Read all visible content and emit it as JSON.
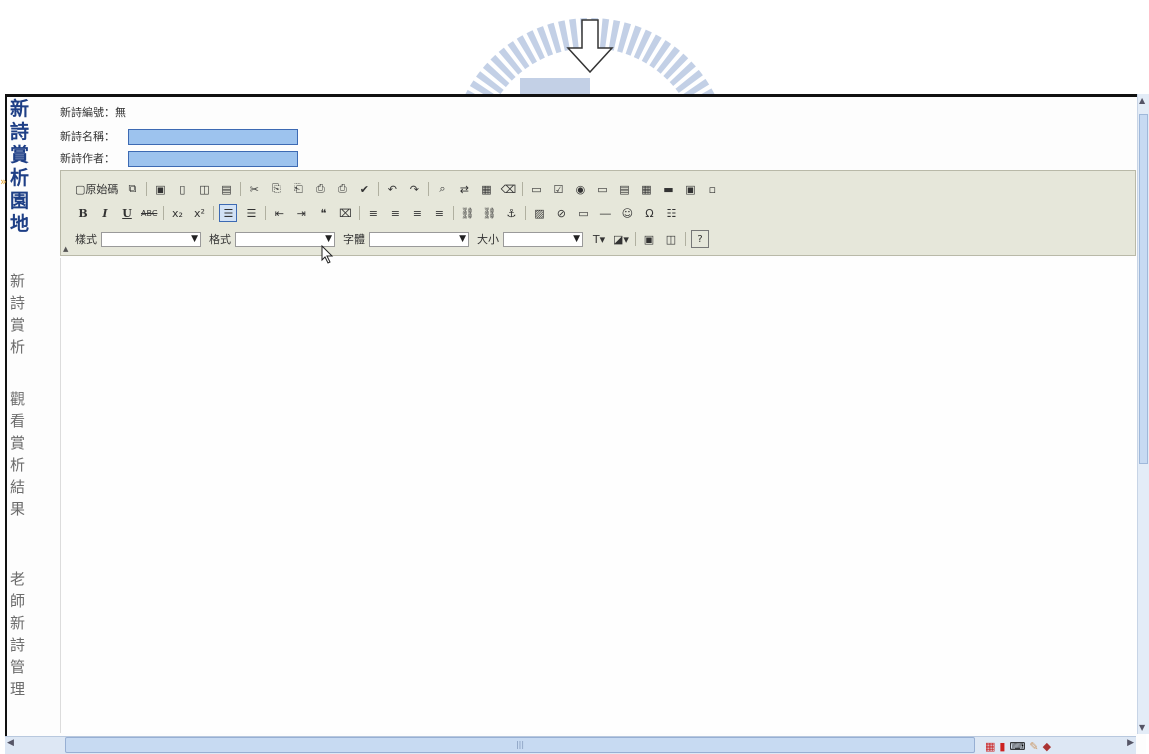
{
  "sidebar": {
    "title_chars": [
      "新",
      "詩",
      "賞",
      "析",
      "園",
      "地"
    ],
    "links": [
      {
        "chars": [
          "新",
          "詩",
          "賞",
          "析"
        ]
      },
      {
        "chars": [
          "觀",
          "看",
          "賞",
          "析",
          "結",
          "果"
        ]
      },
      {
        "chars": [
          "老",
          "師",
          "新",
          "詩",
          "管",
          "理"
        ]
      }
    ]
  },
  "form": {
    "poem_id_label": "新詩編號：無",
    "poem_name_label": "新詩名稱：",
    "poem_author_label": "新詩作者："
  },
  "toolbar": {
    "source_label": "原始碼",
    "bold": "B",
    "italic": "I",
    "underline": "U",
    "strike": "ABC",
    "subscript": "x₂",
    "superscript": "x²",
    "style_label": "樣式",
    "format_label": "格式",
    "font_label": "字體",
    "size_label": "大小",
    "help": "?"
  },
  "colors": {
    "sidebar_title": "#1e3f86",
    "sidebar_link": "#6b6b6b",
    "input_fill": "#9dc3ee",
    "toolbar_bg": "#e6e7da"
  },
  "icons": {
    "row1": [
      "source-icon",
      "copy-icon",
      "save-icon",
      "new-page-icon",
      "preview-icon",
      "template-icon",
      "cut-icon",
      "paste-icon",
      "paste-text-icon",
      "paste-word-icon",
      "print-icon",
      "spellcheck-icon",
      "undo-icon",
      "redo-icon",
      "find-icon",
      "replace-icon",
      "select-all-icon",
      "remove-format-icon",
      "form-icon",
      "checkbox-icon",
      "radio-icon",
      "textfield-icon",
      "textarea-icon",
      "select-icon",
      "button-icon",
      "image-button-icon",
      "hidden-field-icon"
    ],
    "row2": [
      "numbered-list-icon",
      "bulleted-list-icon",
      "outdent-icon",
      "indent-icon",
      "blockquote-icon",
      "div-icon",
      "align-left-icon",
      "align-center-icon",
      "align-right-icon",
      "justify-icon",
      "link-icon",
      "unlink-icon",
      "anchor-icon",
      "image-icon",
      "flash-icon",
      "table-icon",
      "horizontal-rule-icon",
      "smiley-icon",
      "special-char-icon",
      "page-break-icon"
    ]
  }
}
